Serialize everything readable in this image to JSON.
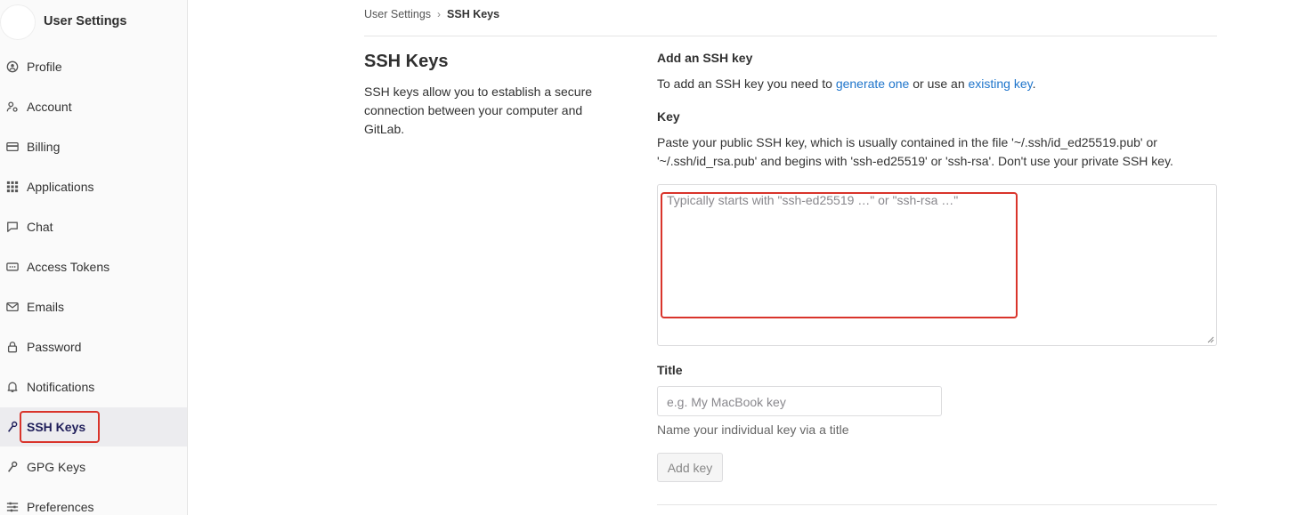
{
  "sidebar": {
    "title": "User Settings",
    "items": [
      {
        "label": "Profile",
        "icon": "profile-icon"
      },
      {
        "label": "Account",
        "icon": "account-icon"
      },
      {
        "label": "Billing",
        "icon": "billing-icon"
      },
      {
        "label": "Applications",
        "icon": "applications-icon"
      },
      {
        "label": "Chat",
        "icon": "chat-icon"
      },
      {
        "label": "Access Tokens",
        "icon": "token-icon"
      },
      {
        "label": "Emails",
        "icon": "mail-icon"
      },
      {
        "label": "Password",
        "icon": "lock-icon"
      },
      {
        "label": "Notifications",
        "icon": "bell-icon"
      },
      {
        "label": "SSH Keys",
        "icon": "key-icon",
        "active": true
      },
      {
        "label": "GPG Keys",
        "icon": "key-icon"
      },
      {
        "label": "Preferences",
        "icon": "preferences-icon"
      }
    ]
  },
  "breadcrumb": {
    "parent": "User Settings",
    "separator": "›",
    "current": "SSH Keys"
  },
  "section": {
    "title": "SSH Keys",
    "description": "SSH keys allow you to establish a secure connection between your computer and GitLab."
  },
  "form": {
    "heading": "Add an SSH key",
    "intro_prefix": "To add an SSH key you need to ",
    "intro_link1": "generate one",
    "intro_middle": " or use an ",
    "intro_link2": "existing key",
    "intro_suffix": ".",
    "key_label": "Key",
    "key_help": "Paste your public SSH key, which is usually contained in the file '~/.ssh/id_ed25519.pub' or '~/.ssh/id_rsa.pub' and begins with 'ssh-ed25519' or 'ssh-rsa'. Don't use your private SSH key.",
    "key_placeholder": "Typically starts with \"ssh-ed25519 …\" or \"ssh-rsa …\"",
    "title_label": "Title",
    "title_placeholder": "e.g. My MacBook key",
    "title_help": "Name your individual key via a title",
    "submit_label": "Add key"
  },
  "colors": {
    "highlight": "#d9342b",
    "link": "#1f75cb",
    "active_nav": "#1f1e5a"
  }
}
